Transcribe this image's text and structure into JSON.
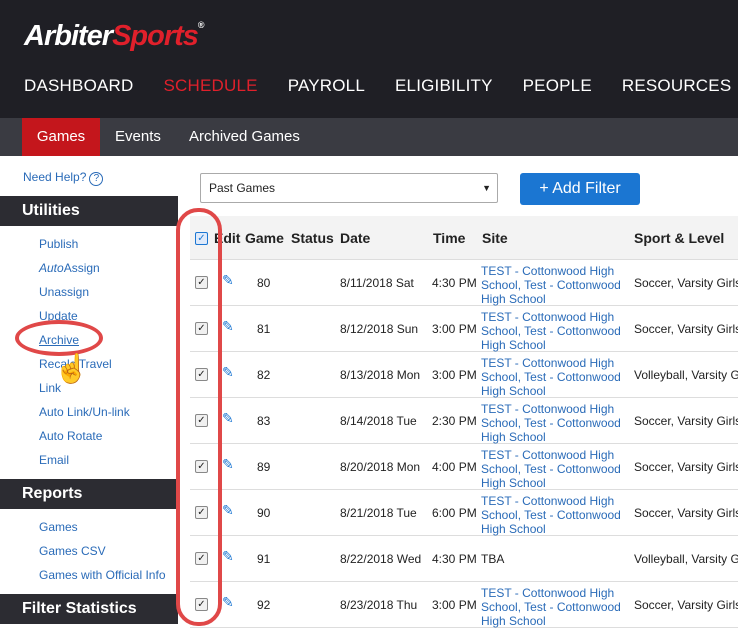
{
  "logo": {
    "part1": "Arbiter",
    "part2": "Sports",
    "mark": "®"
  },
  "mainnav": [
    "DASHBOARD",
    "SCHEDULE",
    "PAYROLL",
    "ELIGIBILITY",
    "PEOPLE",
    "RESOURCES"
  ],
  "subnav": [
    "Games",
    "Events",
    "Archived Games"
  ],
  "sidebar": {
    "help": "Need Help?",
    "help_icon": "?",
    "utilities_title": "Utilities",
    "utilities": [
      {
        "label": "Publish"
      },
      {
        "label": "AutoAssign",
        "italic_prefix": "Auto",
        "rest": "Assign"
      },
      {
        "label": "Unassign"
      },
      {
        "label": "Update"
      },
      {
        "label": "Archive"
      },
      {
        "label": "Recalc Travel"
      },
      {
        "label": "Link"
      },
      {
        "label": "Auto Link/Un-link"
      },
      {
        "label": "Auto Rotate"
      },
      {
        "label": "Email"
      }
    ],
    "reports_title": "Reports",
    "reports": [
      "Games",
      "Games CSV",
      "Games with Official Info"
    ],
    "filter_title": "Filter Statistics"
  },
  "toolbar": {
    "dropdown_value": "Past Games",
    "add_filter": "Add Filter",
    "add_icon": "+"
  },
  "table": {
    "headers": [
      "Edit",
      "Game",
      "Status",
      "Date",
      "Time",
      "Site",
      "Sport & Level"
    ],
    "rows": [
      {
        "game": "80",
        "date": "8/11/2018 Sat",
        "time": "4:30 PM",
        "site": "TEST - Cottonwood High School, Test - Cottonwood High School",
        "sport": "Soccer, Varsity Girls"
      },
      {
        "game": "81",
        "date": "8/12/2018 Sun",
        "time": "3:00 PM",
        "site": "TEST - Cottonwood High School, Test - Cottonwood High School",
        "sport": "Soccer, Varsity Girls"
      },
      {
        "game": "82",
        "date": "8/13/2018 Mon",
        "time": "3:00 PM",
        "site": "TEST - Cottonwood High School, Test - Cottonwood High School",
        "sport": "Volleyball, Varsity G"
      },
      {
        "game": "83",
        "date": "8/14/2018 Tue",
        "time": "2:30 PM",
        "site": "TEST - Cottonwood High School, Test - Cottonwood High School",
        "sport": "Soccer, Varsity Girls"
      },
      {
        "game": "89",
        "date": "8/20/2018 Mon",
        "time": "4:00 PM",
        "site": "TEST - Cottonwood High School, Test - Cottonwood High School",
        "sport": "Soccer, Varsity Girls"
      },
      {
        "game": "90",
        "date": "8/21/2018 Tue",
        "time": "6:00 PM",
        "site": "TEST - Cottonwood High School, Test - Cottonwood High School",
        "sport": "Soccer, Varsity Girls"
      },
      {
        "game": "91",
        "date": "8/22/2018 Wed",
        "time": "4:30 PM",
        "site": "TBA",
        "sport": "Volleyball, Varsity Girl"
      },
      {
        "game": "92",
        "date": "8/23/2018 Thu",
        "time": "3:00 PM",
        "site": "TEST - Cottonwood High School, Test - Cottonwood High School",
        "sport": "Soccer, Varsity Girls"
      }
    ]
  },
  "colors": {
    "accent_red": "#e0202b",
    "link_blue": "#2a6bb8",
    "button_blue": "#1b76d2",
    "highlight_ring": "#e04848"
  }
}
